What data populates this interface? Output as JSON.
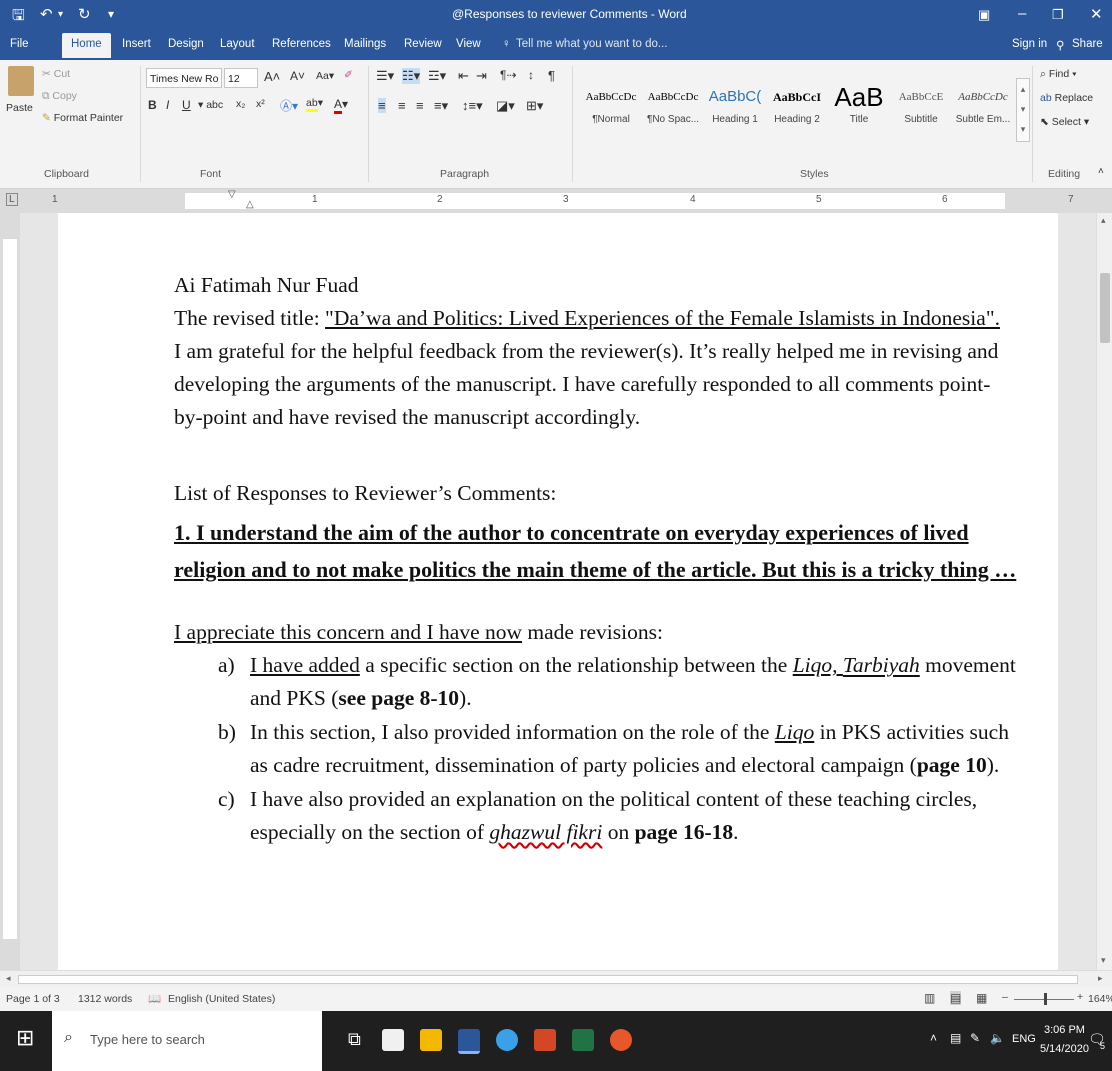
{
  "titlebar": {
    "title": "@Responses to reviewer Comments - Word"
  },
  "tabs": [
    {
      "label": "File"
    },
    {
      "label": "Home"
    },
    {
      "label": "Insert"
    },
    {
      "label": "Design"
    },
    {
      "label": "Layout"
    },
    {
      "label": "References"
    },
    {
      "label": "Mailings"
    },
    {
      "label": "Review"
    },
    {
      "label": "View"
    }
  ],
  "tellme": "Tell me what you want to do...",
  "signin": "Sign in",
  "share": "Share",
  "clipboard": {
    "paste": "Paste",
    "cut": "Cut",
    "copy": "Copy",
    "format_painter": "Format Painter",
    "group": "Clipboard"
  },
  "font": {
    "name": "Times New Ro",
    "size": "12",
    "group": "Font"
  },
  "paragraph": {
    "group": "Paragraph"
  },
  "styles": {
    "group": "Styles",
    "items": [
      {
        "preview": "AaBbCcDc",
        "name": "¶Normal"
      },
      {
        "preview": "AaBbCcDc",
        "name": "¶No Spac..."
      },
      {
        "preview": "AaBbC(",
        "name": "Heading 1"
      },
      {
        "preview": "AaBbCcI",
        "name": "Heading 2"
      },
      {
        "preview": "AaB",
        "name": "Title"
      },
      {
        "preview": "AaBbCcE",
        "name": "Subtitle"
      },
      {
        "preview": "AaBbCcDc",
        "name": "Subtle Em..."
      }
    ]
  },
  "editing": {
    "find": "Find",
    "replace": "Replace",
    "select": "Select",
    "group": "Editing"
  },
  "ruler": [
    "1",
    "1",
    "2",
    "3",
    "4",
    "5",
    "6",
    "7"
  ],
  "doc": {
    "author": "Ai Fatimah Nur Fuad",
    "title_prefix": "The revised title: ",
    "title_value": "\"Da’wa and Politics: Lived Experiences of the Female Islamists in Indonesia\".",
    "para1_l1": "I am grateful for the helpful feedback from the reviewer(s). It’s really helped me in revising and",
    "para1_l2": "developing the arguments of the manuscript. I have carefully responded to all comments point-",
    "para1_l3": "by-point and have revised the manuscript accordingly.",
    "list_heading": "List of Responses to Reviewer’s Comments:",
    "comment1_l1": "1. I understand the aim of the author to concentrate on everyday experiences of lived",
    "comment1_l2": "religion and to not make politics the main theme of the article. But this is a tricky thing …",
    "resp_intro_u": "I appreciate this concern and I have now",
    "resp_intro_rest": " made revisions:",
    "a_marker": "a)",
    "a_u": "I have added",
    "a_t1": " a specific section on the relationship between the ",
    "a_liqo": "Liqo, ",
    "a_tarbiyah": "Tarbiyah",
    "a_t2": " movement",
    "a_l2a": "and PKS (",
    "a_l2b": "see page 8-10",
    "a_l2c": ").",
    "b_marker": "b)",
    "b_t1": "In this section, I also provided information on the role of the ",
    "b_liqo": "Liqo",
    "b_t2": " in PKS activities such",
    "b_l2a": "as cadre recruitment, dissemination of party policies and electoral campaign (",
    "b_l2b": "page 10",
    "b_l2c": ").",
    "c_marker": "c)",
    "c_l1": "I have also provided an explanation on the political content of these teaching circles,",
    "c_l2a": "especially on the section of ",
    "c_l2b": "ghazwul fikri",
    "c_l2c": " on ",
    "c_l2d": "page 16-18",
    "c_l2e": "."
  },
  "status": {
    "page": "Page 1 of 3",
    "words": "1312 words",
    "language": "English (United States)",
    "zoom": "164%"
  },
  "taskbar": {
    "search": "Type here to search",
    "lang": "ENG",
    "time": "3:06 PM",
    "date": "5/14/2020",
    "notif": "5"
  }
}
